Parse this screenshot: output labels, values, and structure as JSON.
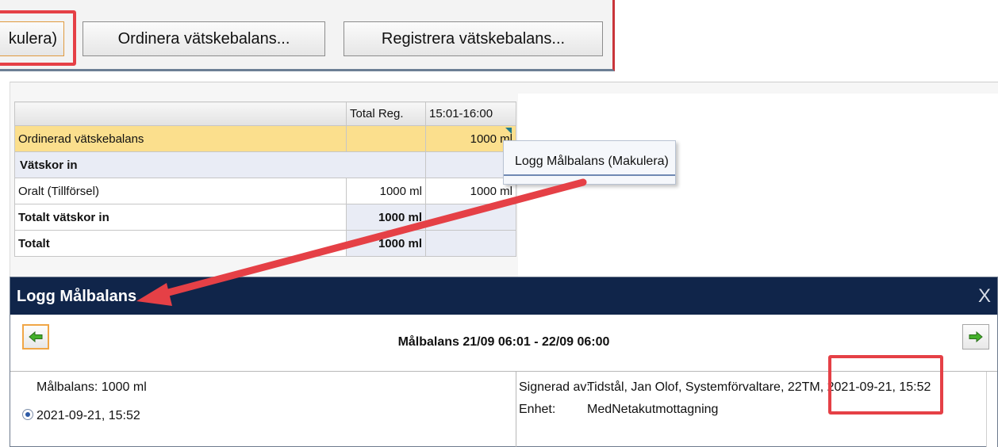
{
  "toolbar": {
    "partial_button_label": "kulera)",
    "ordinera_label": "Ordinera vätskebalans...",
    "registrera_label": "Registrera vätskebalans..."
  },
  "fluid_table": {
    "headers": [
      "",
      "Total Reg.",
      "15:01-16:00"
    ],
    "rows": [
      {
        "label": "Ordinerad vätskebalans",
        "total": "",
        "slot": "1000 ml"
      },
      {
        "label": "Vätskor in",
        "total": "",
        "slot": ""
      },
      {
        "label": "Oralt (Tillförsel)",
        "total": "1000 ml",
        "slot": "1000 ml"
      },
      {
        "label": "Totalt vätskor in",
        "total": "1000 ml",
        "slot": ""
      },
      {
        "label": "Totalt",
        "total": "1000 ml",
        "slot": ""
      }
    ]
  },
  "context_menu": {
    "items": [
      {
        "label": "Logg Målbalans (Makulera)"
      }
    ]
  },
  "dialog": {
    "title": "Logg Målbalans",
    "close_label": "X",
    "nav_title": "Målbalans 21/09 06:01 - 22/09 06:00",
    "entry": {
      "line1": "Målbalans: 1000 ml",
      "line2": "2021-09-21, 15:52"
    },
    "details": {
      "signed_label": "Signerad av:",
      "signed_value": "Tidstål, Jan Olof, Systemförvaltare, 22TM, 2021-09-21, 15:52",
      "unit_label": "Enhet:",
      "unit_value": "MedNetakutmottagning"
    }
  },
  "icons": {
    "prev": "green-arrow-left-icon",
    "next": "green-arrow-right-icon"
  },
  "colors": {
    "accent_red": "#e54046",
    "dialog_title_bg": "#10254a",
    "selected_row": "#fbdf8d",
    "group_row": "#e9ecf5"
  }
}
